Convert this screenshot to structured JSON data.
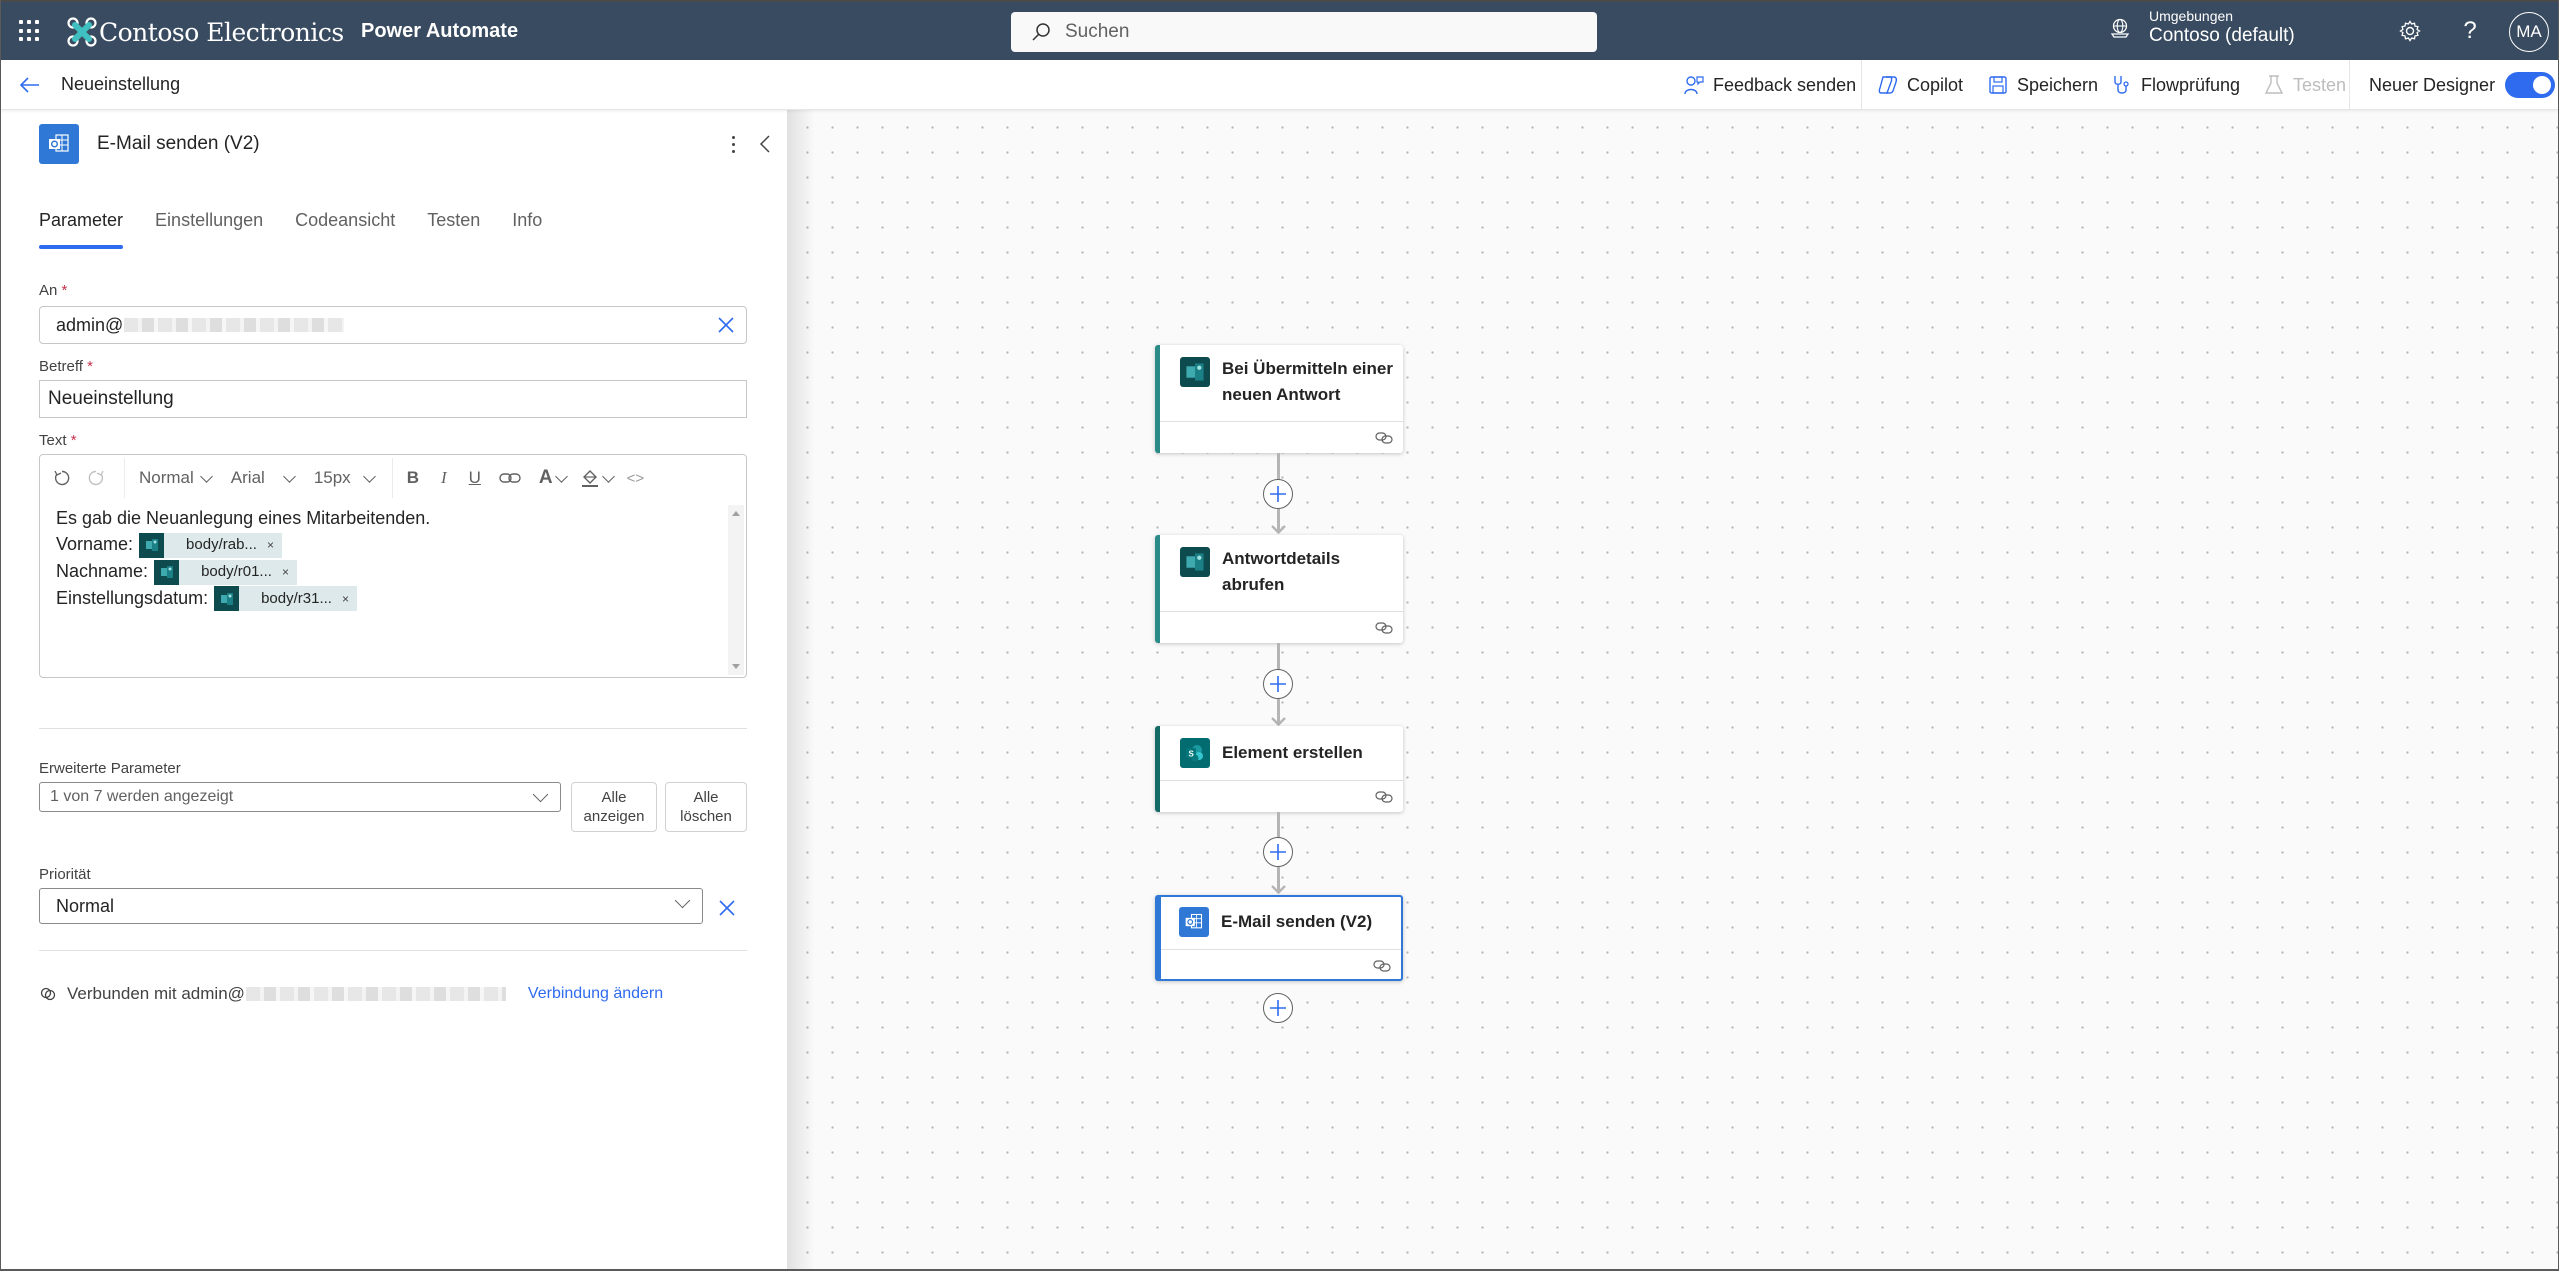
{
  "header": {
    "brand": "Contoso Electronics",
    "app_name": "Power Automate",
    "search_placeholder": "Suchen",
    "environment_label": "Umgebungen",
    "environment_value": "Contoso (default)",
    "avatar_initials": "MA"
  },
  "commandbar": {
    "flow_name": "Neueinstellung",
    "feedback": "Feedback senden",
    "copilot": "Copilot",
    "save": "Speichern",
    "flow_checker": "Flowprüfung",
    "test": "Testen",
    "new_designer": "Neuer Designer",
    "new_designer_on": true
  },
  "panel": {
    "title": "E-Mail senden (V2)",
    "tabs": [
      "Parameter",
      "Einstellungen",
      "Codeansicht",
      "Testen",
      "Info"
    ],
    "active_tab": "Parameter",
    "to_label": "An",
    "to_value": "admin@",
    "subject_label": "Betreff",
    "subject_value": "Neueinstellung",
    "body_label": "Text",
    "required_mark": "*",
    "toolbar": {
      "style": "Normal",
      "font": "Arial",
      "size": "15px",
      "bold": "B",
      "italic": "I",
      "underline": "U",
      "font_color": "A",
      "code": "<>"
    },
    "body": {
      "line1": "Es gab die Neuanlegung eines Mitarbeitenden.",
      "fields": [
        {
          "label": "Vorname:",
          "token": "body/rab..."
        },
        {
          "label": "Nachname:",
          "token": "body/r01..."
        },
        {
          "label": "Einstellungsdatum:",
          "token": "body/r31..."
        }
      ],
      "token_remove": "×"
    },
    "advanced_label": "Erweiterte Parameter",
    "advanced_value": "1 von 7 werden angezeigt",
    "show_all": "Alle anzeigen",
    "clear_all": "Alle löschen",
    "priority_label": "Priorität",
    "priority_value": "Normal",
    "connected_prefix": "Verbunden mit admin@",
    "change_connection": "Verbindung ändern"
  },
  "canvas": {
    "nodes": [
      {
        "title": "Bei Übermitteln einer neuen Antwort",
        "connector": "forms",
        "selected": false
      },
      {
        "title": "Antwortdetails abrufen",
        "connector": "forms",
        "selected": false
      },
      {
        "title": "Element erstellen",
        "connector": "sharepoint",
        "selected": false
      },
      {
        "title": "E-Mail senden (V2)",
        "connector": "outlook",
        "selected": true
      }
    ]
  },
  "colors": {
    "header_bg": "#394b60",
    "accent": "#2f6bef",
    "forms": "#0d4b4e",
    "sharepoint": "#036c70",
    "outlook": "#2f78d6"
  }
}
